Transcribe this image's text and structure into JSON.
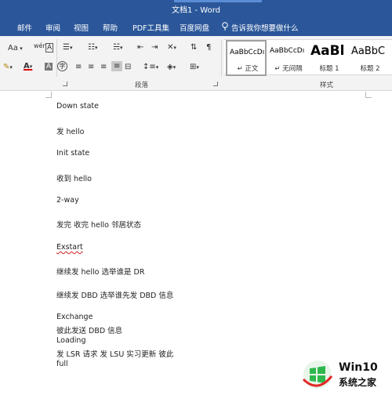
{
  "window": {
    "title": "文档1 - Word"
  },
  "menu": {
    "tabs": [
      "邮件",
      "审阅",
      "视图",
      "帮助",
      "PDF工具集",
      "百度网盘"
    ],
    "tell_me": "告诉我你想要做什么"
  },
  "ribbon": {
    "font_size_label": "Aa",
    "groups": {
      "paragraph": "段落",
      "styles": "样式"
    },
    "styles": [
      {
        "sample": "AaBbCcDı",
        "name": "↵ 正文"
      },
      {
        "sample": "AaBbCcDı",
        "name": "↵ 无间隔"
      },
      {
        "sample": "AaBl",
        "name": "标题 1"
      },
      {
        "sample": "AaBbC",
        "name": "标题 2"
      }
    ]
  },
  "document": {
    "lines": [
      "Down state",
      "发 hello",
      "Init state",
      "收到 hello",
      "2-way",
      "发完  收完  hello  邻居状态",
      "Exstart",
      "继续发 hello  选举谁是 DR",
      "继续发 DBD  选举谁先发 DBD 信息",
      "Exchange",
      "彼此发送 DBD 信息",
      "Loading",
      "发 LSR 请求  发 LSU 实习更新  彼此",
      "full"
    ]
  },
  "watermark": {
    "brand": "Win10",
    "site": "系统之家"
  },
  "colors": {
    "accent": "#2b579a",
    "logo_red": "#e32726",
    "logo_green": "#2db84d"
  }
}
